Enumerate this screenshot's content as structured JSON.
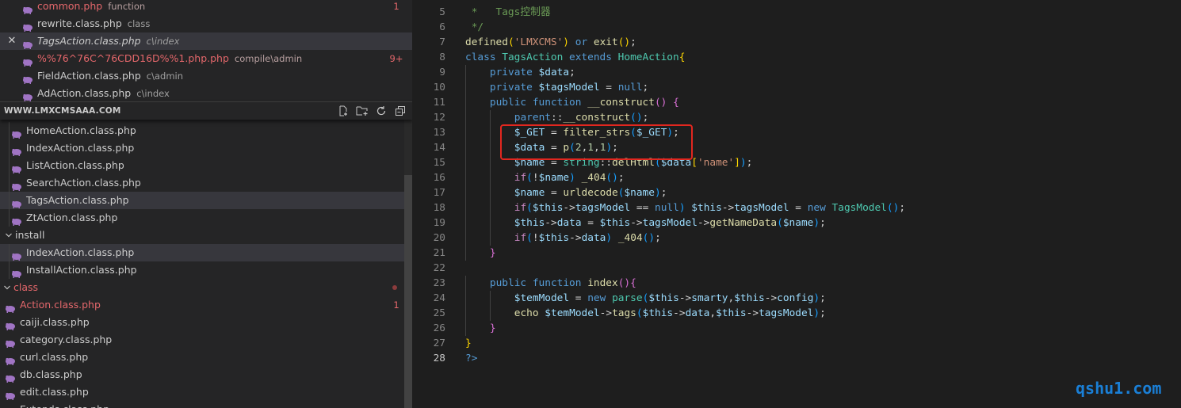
{
  "open_editors": [
    {
      "close": "",
      "name": "common.php",
      "desc": "function",
      "badge": "1",
      "modified": true,
      "italic": false,
      "active": false
    },
    {
      "close": "",
      "name": "rewrite.class.php",
      "desc": "class",
      "badge": "",
      "modified": false,
      "italic": false,
      "active": false
    },
    {
      "close": "✕",
      "name": "TagsAction.class.php",
      "desc": "c\\index",
      "badge": "",
      "modified": false,
      "italic": true,
      "active": true
    },
    {
      "close": "",
      "name": "%%76^76C^76CDD16D%%1.php.php",
      "desc": "compile\\admin",
      "badge": "9+",
      "modified": true,
      "italic": false,
      "active": false
    },
    {
      "close": "",
      "name": "FieldAction.class.php",
      "desc": "c\\admin",
      "badge": "",
      "modified": false,
      "italic": false,
      "active": false
    },
    {
      "close": "",
      "name": "AdAction.class.php",
      "desc": "c\\index",
      "badge": "",
      "modified": false,
      "italic": false,
      "active": false
    }
  ],
  "explorer": {
    "title": "WWW.LMXCMSAAA.COM",
    "actions": [
      "new-file-icon",
      "new-folder-icon",
      "refresh-icon",
      "collapse-all-icon"
    ]
  },
  "tree": [
    {
      "kind": "file",
      "level": 1,
      "name": "HomeAction.class.php",
      "active": false,
      "modified": false,
      "badge": ""
    },
    {
      "kind": "file",
      "level": 1,
      "name": "IndexAction.class.php",
      "active": false,
      "modified": false,
      "badge": ""
    },
    {
      "kind": "file",
      "level": 1,
      "name": "ListAction.class.php",
      "active": false,
      "modified": false,
      "badge": ""
    },
    {
      "kind": "file",
      "level": 1,
      "name": "SearchAction.class.php",
      "active": false,
      "modified": false,
      "badge": ""
    },
    {
      "kind": "file",
      "level": 1,
      "name": "TagsAction.class.php",
      "active": true,
      "modified": false,
      "badge": ""
    },
    {
      "kind": "file",
      "level": 1,
      "name": "ZtAction.class.php",
      "active": false,
      "modified": false,
      "badge": ""
    },
    {
      "kind": "folder",
      "level": 0.5,
      "name": "install",
      "active": false,
      "modified": false,
      "badge": ""
    },
    {
      "kind": "file",
      "level": 1,
      "name": "IndexAction.class.php",
      "active": true,
      "modified": false,
      "badge": ""
    },
    {
      "kind": "file",
      "level": 1,
      "name": "InstallAction.class.php",
      "active": false,
      "modified": false,
      "badge": ""
    },
    {
      "kind": "folder",
      "level": 0,
      "name": "class",
      "active": false,
      "modified": true,
      "badge": "",
      "dot": true
    },
    {
      "kind": "file",
      "level": 0,
      "name": "Action.class.php",
      "active": false,
      "modified": true,
      "badge": "1"
    },
    {
      "kind": "file",
      "level": 0,
      "name": "caiji.class.php",
      "active": false,
      "modified": false,
      "badge": ""
    },
    {
      "kind": "file",
      "level": 0,
      "name": "category.class.php",
      "active": false,
      "modified": false,
      "badge": ""
    },
    {
      "kind": "file",
      "level": 0,
      "name": "curl.class.php",
      "active": false,
      "modified": false,
      "badge": ""
    },
    {
      "kind": "file",
      "level": 0,
      "name": "db.class.php",
      "active": false,
      "modified": false,
      "badge": ""
    },
    {
      "kind": "file",
      "level": 0,
      "name": "edit.class.php",
      "active": false,
      "modified": false,
      "badge": ""
    },
    {
      "kind": "file",
      "level": 0,
      "name": "Extends.class.php",
      "active": false,
      "modified": false,
      "badge": ""
    }
  ],
  "code": {
    "current_line": "28",
    "lines": [
      {
        "n": "5",
        "indent": 0,
        "t": [
          [
            "c",
            " *   Tags控制器"
          ]
        ]
      },
      {
        "n": "6",
        "indent": 0,
        "t": [
          [
            "c",
            " */"
          ]
        ]
      },
      {
        "n": "7",
        "indent": 0,
        "t": [
          [
            "f",
            "defined"
          ],
          [
            "y",
            "("
          ],
          [
            "s",
            "'LMXCMS'"
          ],
          [
            "y",
            ")"
          ],
          [
            "p",
            " "
          ],
          [
            "k",
            "or"
          ],
          [
            "p",
            " "
          ],
          [
            "f",
            "exit"
          ],
          [
            "y",
            "()"
          ],
          [
            "p",
            ";"
          ]
        ]
      },
      {
        "n": "8",
        "indent": 0,
        "t": [
          [
            "k",
            "class"
          ],
          [
            "p",
            " "
          ],
          [
            "cls",
            "TagsAction"
          ],
          [
            "p",
            " "
          ],
          [
            "k",
            "extends"
          ],
          [
            "p",
            " "
          ],
          [
            "cls",
            "HomeAction"
          ],
          [
            "y",
            "{"
          ]
        ]
      },
      {
        "n": "9",
        "indent": 1,
        "t": [
          [
            "k",
            "private"
          ],
          [
            "p",
            " "
          ],
          [
            "v",
            "$data"
          ],
          [
            "p",
            ";"
          ]
        ]
      },
      {
        "n": "10",
        "indent": 1,
        "t": [
          [
            "k",
            "private"
          ],
          [
            "p",
            " "
          ],
          [
            "v",
            "$tagsModel"
          ],
          [
            "p",
            " = "
          ],
          [
            "k",
            "null"
          ],
          [
            "p",
            ";"
          ]
        ]
      },
      {
        "n": "11",
        "indent": 1,
        "t": [
          [
            "k",
            "public"
          ],
          [
            "p",
            " "
          ],
          [
            "k",
            "function"
          ],
          [
            "p",
            " "
          ],
          [
            "f",
            "__construct"
          ],
          [
            "pk",
            "()"
          ],
          [
            "p",
            " "
          ],
          [
            "pk",
            "{"
          ]
        ]
      },
      {
        "n": "12",
        "indent": 2,
        "t": [
          [
            "k",
            "parent"
          ],
          [
            "p",
            "::"
          ],
          [
            "f",
            "__construct"
          ],
          [
            "bl",
            "()"
          ],
          [
            "p",
            ";"
          ]
        ]
      },
      {
        "n": "13",
        "indent": 2,
        "t": [
          [
            "v",
            "$_GET"
          ],
          [
            "p",
            " = "
          ],
          [
            "f",
            "filter_strs"
          ],
          [
            "bl",
            "("
          ],
          [
            "v",
            "$_GET"
          ],
          [
            "bl",
            ")"
          ],
          [
            "p",
            ";"
          ]
        ]
      },
      {
        "n": "14",
        "indent": 2,
        "t": [
          [
            "v",
            "$data"
          ],
          [
            "p",
            " = "
          ],
          [
            "f",
            "p"
          ],
          [
            "bl",
            "("
          ],
          [
            "n",
            "2"
          ],
          [
            "p",
            ","
          ],
          [
            "n",
            "1"
          ],
          [
            "p",
            ","
          ],
          [
            "n",
            "1"
          ],
          [
            "bl",
            ")"
          ],
          [
            "p",
            ";"
          ]
        ]
      },
      {
        "n": "15",
        "indent": 2,
        "t": [
          [
            "v",
            "$name"
          ],
          [
            "p",
            " = "
          ],
          [
            "cls",
            "string"
          ],
          [
            "p",
            "::"
          ],
          [
            "f",
            "delHtml"
          ],
          [
            "bl",
            "("
          ],
          [
            "v",
            "$data"
          ],
          [
            "y",
            "["
          ],
          [
            "s",
            "'name'"
          ],
          [
            "y",
            "]"
          ],
          [
            "bl",
            ")"
          ],
          [
            "p",
            ";"
          ]
        ]
      },
      {
        "n": "16",
        "indent": 2,
        "t": [
          [
            "ctrl",
            "if"
          ],
          [
            "bl",
            "("
          ],
          [
            "p",
            "!"
          ],
          [
            "v",
            "$name"
          ],
          [
            "bl",
            ")"
          ],
          [
            "p",
            " "
          ],
          [
            "f",
            "_404"
          ],
          [
            "bl",
            "()"
          ],
          [
            "p",
            ";"
          ]
        ]
      },
      {
        "n": "17",
        "indent": 2,
        "t": [
          [
            "v",
            "$name"
          ],
          [
            "p",
            " = "
          ],
          [
            "f",
            "urldecode"
          ],
          [
            "bl",
            "("
          ],
          [
            "v",
            "$name"
          ],
          [
            "bl",
            ")"
          ],
          [
            "p",
            ";"
          ]
        ]
      },
      {
        "n": "18",
        "indent": 2,
        "t": [
          [
            "ctrl",
            "if"
          ],
          [
            "bl",
            "("
          ],
          [
            "v",
            "$this"
          ],
          [
            "p",
            "->"
          ],
          [
            "v",
            "tagsModel"
          ],
          [
            "p",
            " == "
          ],
          [
            "k",
            "null"
          ],
          [
            "bl",
            ")"
          ],
          [
            "p",
            " "
          ],
          [
            "v",
            "$this"
          ],
          [
            "p",
            "->"
          ],
          [
            "v",
            "tagsModel"
          ],
          [
            "p",
            " = "
          ],
          [
            "k",
            "new"
          ],
          [
            "p",
            " "
          ],
          [
            "cls",
            "TagsModel"
          ],
          [
            "bl",
            "()"
          ],
          [
            "p",
            ";"
          ]
        ]
      },
      {
        "n": "19",
        "indent": 2,
        "t": [
          [
            "v",
            "$this"
          ],
          [
            "p",
            "->"
          ],
          [
            "v",
            "data"
          ],
          [
            "p",
            " = "
          ],
          [
            "v",
            "$this"
          ],
          [
            "p",
            "->"
          ],
          [
            "v",
            "tagsModel"
          ],
          [
            "p",
            "->"
          ],
          [
            "f",
            "getNameData"
          ],
          [
            "bl",
            "("
          ],
          [
            "v",
            "$name"
          ],
          [
            "bl",
            ")"
          ],
          [
            "p",
            ";"
          ]
        ]
      },
      {
        "n": "20",
        "indent": 2,
        "t": [
          [
            "ctrl",
            "if"
          ],
          [
            "bl",
            "("
          ],
          [
            "p",
            "!"
          ],
          [
            "v",
            "$this"
          ],
          [
            "p",
            "->"
          ],
          [
            "v",
            "data"
          ],
          [
            "bl",
            ")"
          ],
          [
            "p",
            " "
          ],
          [
            "f",
            "_404"
          ],
          [
            "bl",
            "()"
          ],
          [
            "p",
            ";"
          ]
        ]
      },
      {
        "n": "21",
        "indent": 1,
        "t": [
          [
            "pk",
            "}"
          ]
        ]
      },
      {
        "n": "22",
        "indent": 0,
        "t": []
      },
      {
        "n": "23",
        "indent": 1,
        "t": [
          [
            "k",
            "public"
          ],
          [
            "p",
            " "
          ],
          [
            "k",
            "function"
          ],
          [
            "p",
            " "
          ],
          [
            "f",
            "index"
          ],
          [
            "pk",
            "(){"
          ]
        ]
      },
      {
        "n": "24",
        "indent": 2,
        "t": [
          [
            "v",
            "$temModel"
          ],
          [
            "p",
            " = "
          ],
          [
            "k",
            "new"
          ],
          [
            "p",
            " "
          ],
          [
            "cls",
            "parse"
          ],
          [
            "bl",
            "("
          ],
          [
            "v",
            "$this"
          ],
          [
            "p",
            "->"
          ],
          [
            "v",
            "smarty"
          ],
          [
            "p",
            ","
          ],
          [
            "v",
            "$this"
          ],
          [
            "p",
            "->"
          ],
          [
            "v",
            "config"
          ],
          [
            "bl",
            ")"
          ],
          [
            "p",
            ";"
          ]
        ]
      },
      {
        "n": "25",
        "indent": 2,
        "t": [
          [
            "f",
            "echo"
          ],
          [
            "p",
            " "
          ],
          [
            "v",
            "$temModel"
          ],
          [
            "p",
            "->"
          ],
          [
            "f",
            "tags"
          ],
          [
            "bl",
            "("
          ],
          [
            "v",
            "$this"
          ],
          [
            "p",
            "->"
          ],
          [
            "v",
            "data"
          ],
          [
            "p",
            ","
          ],
          [
            "v",
            "$this"
          ],
          [
            "p",
            "->"
          ],
          [
            "v",
            "tagsModel"
          ],
          [
            "bl",
            ")"
          ],
          [
            "p",
            ";"
          ]
        ]
      },
      {
        "n": "26",
        "indent": 1,
        "t": [
          [
            "pk",
            "}"
          ]
        ]
      },
      {
        "n": "27",
        "indent": 0,
        "t": [
          [
            "y",
            "}"
          ]
        ]
      },
      {
        "n": "28",
        "indent": 0,
        "t": [
          [
            "tagk",
            "?>"
          ]
        ]
      }
    ]
  },
  "watermark": "qshu1.com",
  "colors": {
    "php_icon": "#a074c4",
    "modified": "#e4676b",
    "highlight_box": "#e2271f"
  }
}
